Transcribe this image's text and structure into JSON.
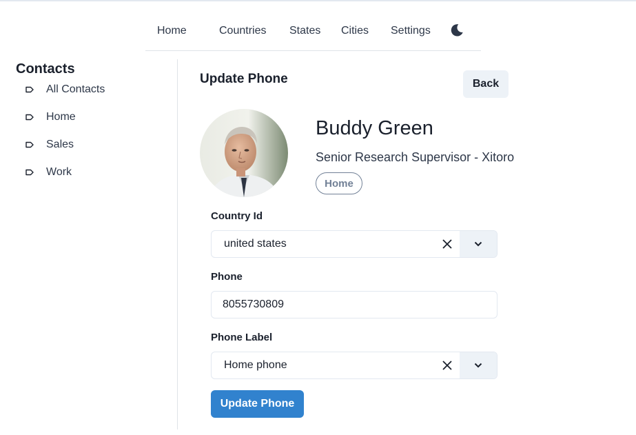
{
  "nav": {
    "home": "Home",
    "countries": "Countries",
    "states": "States",
    "cities": "Cities",
    "settings": "Settings",
    "theme_icon": "moon-icon"
  },
  "sidebar": {
    "title": "Contacts",
    "items": [
      {
        "label": "All Contacts",
        "icon": "tag-icon"
      },
      {
        "label": "Home",
        "icon": "tag-icon"
      },
      {
        "label": "Sales",
        "icon": "tag-icon"
      },
      {
        "label": "Work",
        "icon": "tag-icon"
      }
    ]
  },
  "main": {
    "title": "Update Phone",
    "back_label": "Back",
    "contact": {
      "name": "Buddy Green",
      "role": "Senior Research Supervisor - Xitoro",
      "badge": "Home"
    },
    "form": {
      "country_label": "Country Id",
      "country_value": "united states",
      "phone_label": "Phone",
      "phone_value": "8055730809",
      "phone_label_label": "Phone Label",
      "phone_label_value": "Home phone",
      "submit_label": "Update Phone"
    }
  },
  "colors": {
    "primary": "#3182ce",
    "muted_bg": "#edf2f7",
    "border": "#e2e8f0",
    "badge": "#718096"
  }
}
